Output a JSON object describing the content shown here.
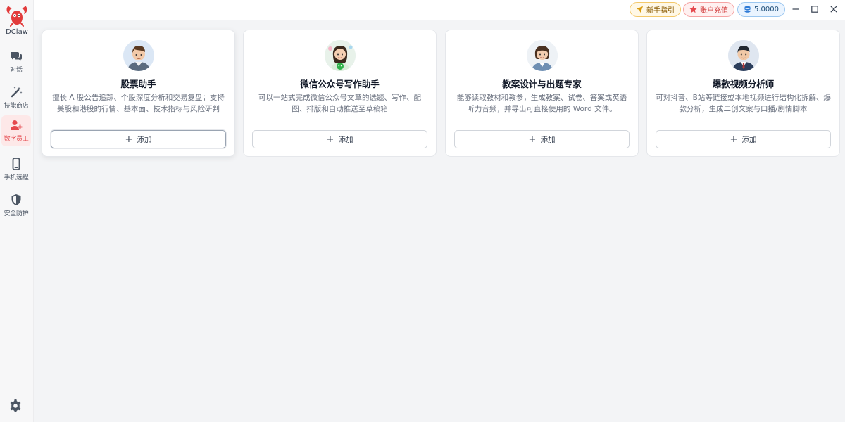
{
  "app": {
    "name": "DClaw"
  },
  "sidebar": {
    "items": [
      {
        "id": "chat",
        "label": "对话"
      },
      {
        "id": "skills",
        "label": "技能商店"
      },
      {
        "id": "digital-staff",
        "label": "数字员工",
        "active": true
      },
      {
        "id": "phone-remote",
        "label": "手机远程"
      },
      {
        "id": "security",
        "label": "安全防护"
      }
    ]
  },
  "topbar": {
    "guide_label": "新手指引",
    "recharge_label": "账户充值",
    "balance": "5.0000"
  },
  "colors": {
    "accent": "#e5484d",
    "guide": "#f3c86a",
    "recharge": "#f5a3a3",
    "balance": "#9cc7f0"
  },
  "cards": [
    {
      "title": "股票助手",
      "description": "擅长 A 股公告追踪、个股深度分析和交易复盘；支持美股和港股的行情、基本面、技术指标与风险研判",
      "add_label": "添加"
    },
    {
      "title": "微信公众号写作助手",
      "description": "可以一站式完成微信公众号文章的选题、写作、配图、排版和自动推送至草稿箱",
      "add_label": "添加"
    },
    {
      "title": "教案设计与出题专家",
      "description": "能够读取教材和教参，生成教案、试卷、答案或英语听力音频，并导出可直接使用的 Word 文件。",
      "add_label": "添加"
    },
    {
      "title": "爆款视频分析师",
      "description": "可对抖音、B站等链接或本地视频进行结构化拆解、爆款分析，生成二创文案与口播/剧情脚本",
      "add_label": "添加"
    }
  ]
}
